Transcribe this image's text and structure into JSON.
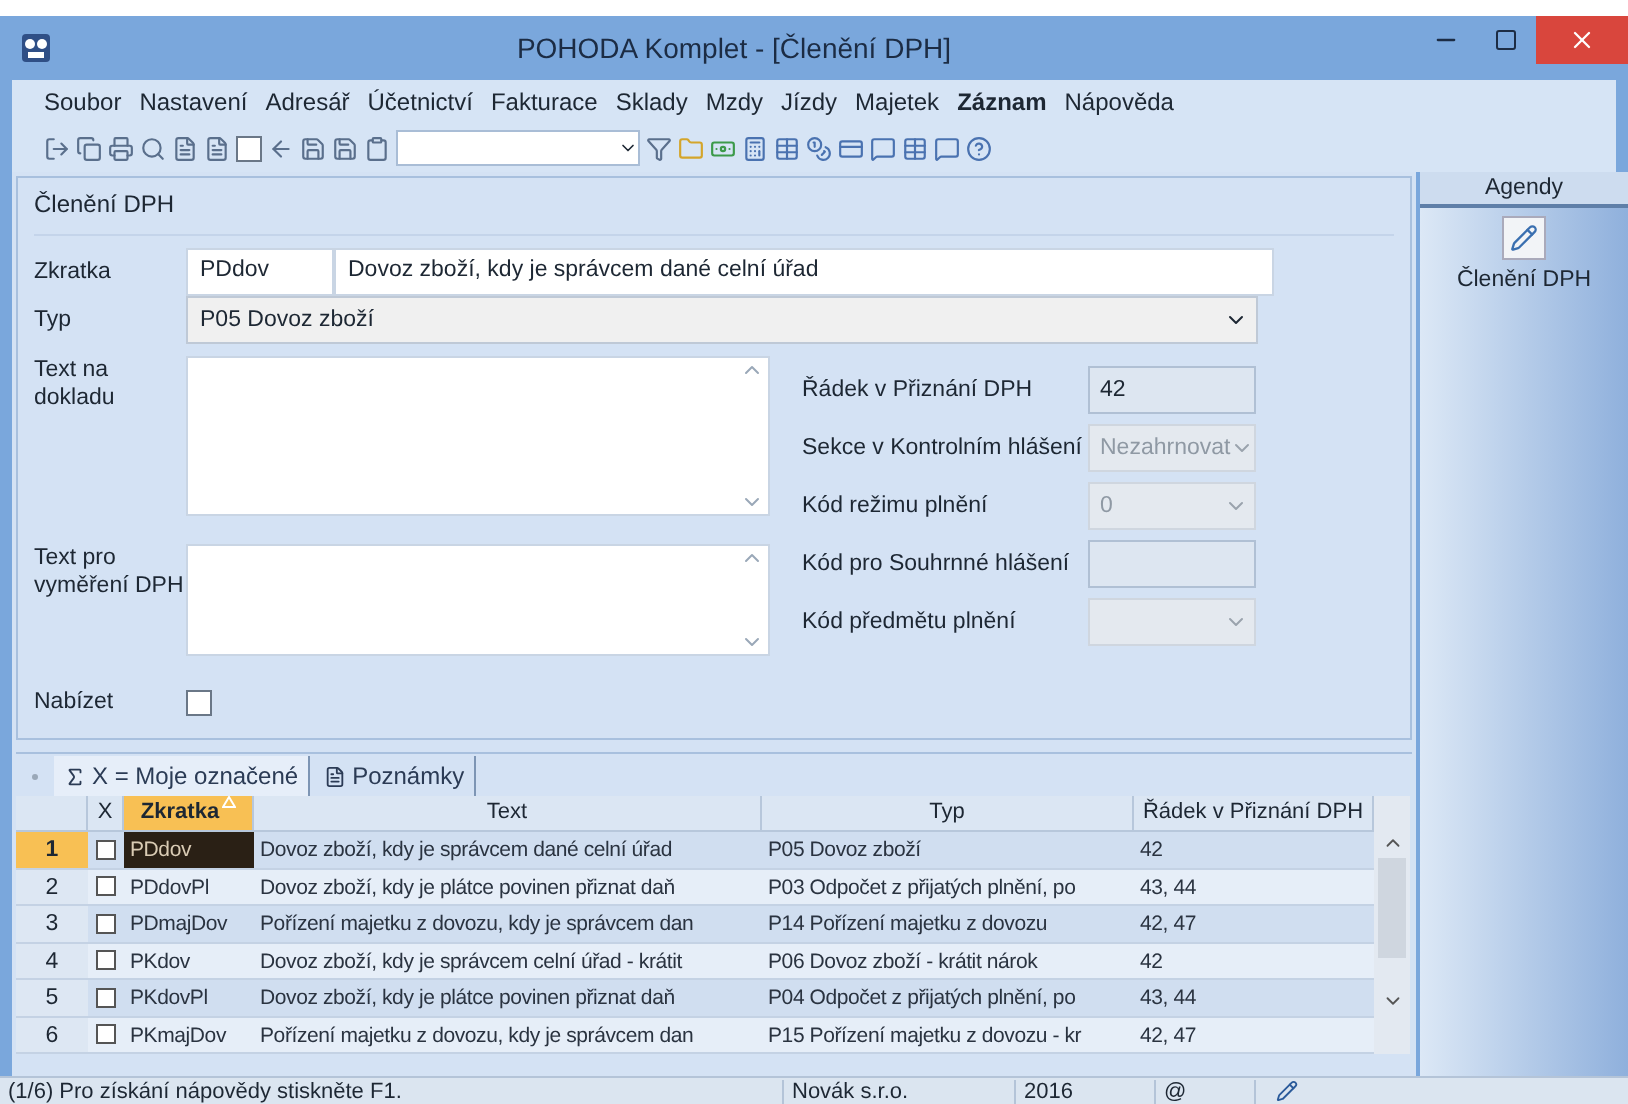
{
  "window": {
    "title": "POHODA Komplet - [Členění DPH]"
  },
  "menu": [
    {
      "label": "Soubor",
      "bold": false
    },
    {
      "label": "Nastavení",
      "bold": false
    },
    {
      "label": "Adresář",
      "bold": false
    },
    {
      "label": "Účetnictví",
      "bold": false
    },
    {
      "label": "Fakturace",
      "bold": false
    },
    {
      "label": "Sklady",
      "bold": false
    },
    {
      "label": "Mzdy",
      "bold": false
    },
    {
      "label": "Jízdy",
      "bold": false
    },
    {
      "label": "Majetek",
      "bold": false
    },
    {
      "label": "Záznam",
      "bold": true
    },
    {
      "label": "Nápověda",
      "bold": false
    }
  ],
  "form": {
    "title": "Členění DPH",
    "zkratka": {
      "label": "Zkratka",
      "code": "PDdov",
      "name": "Dovoz zboží, kdy je správcem dané celní úřad"
    },
    "typ": {
      "label": "Typ",
      "value": "P05 Dovoz zboží"
    },
    "text_na_dokladu": {
      "label": "Text na dokladu"
    },
    "text_pro_vymereni": {
      "label": "Text pro vyměření DPH"
    },
    "nabizet": {
      "label": "Nabízet",
      "checked": false
    },
    "right_fields": [
      {
        "label": "Řádek v Přiznání DPH",
        "value": "42",
        "kind": "text",
        "disabled": false
      },
      {
        "label": "Sekce v Kontrolním hlášení",
        "value": "Nezahrnovat",
        "kind": "select",
        "disabled": true
      },
      {
        "label": "Kód režimu plnění",
        "value": "0",
        "kind": "select",
        "disabled": true
      },
      {
        "label": "Kód pro Souhrnné hlášení",
        "kind": "text",
        "disabled": false
      },
      {
        "label": "Kód předmětu plnění",
        "kind": "select",
        "disabled": true
      }
    ]
  },
  "agendy": {
    "title": "Agendy",
    "items": [
      {
        "label": "Členění DPH"
      }
    ]
  },
  "tabs": [
    {
      "label": "X = Moje označené",
      "selected": true
    },
    {
      "label": "Poznámky",
      "selected": false
    }
  ],
  "table": {
    "check_column": "X",
    "columns": [
      "Zkratka",
      "Text",
      "Typ",
      "Řádek v Přiznání DPH"
    ],
    "rows": [
      {
        "number": "1",
        "checked": false,
        "selected": true,
        "cells": [
          "PDdov",
          "Dovoz zboží, kdy je správcem dané celní úřad",
          "P05 Dovoz zboží",
          "42"
        ]
      },
      {
        "number": "2",
        "checked": false,
        "selected": false,
        "cells": [
          "PDdovPl",
          "Dovoz zboží, kdy je plátce povinen přiznat daň",
          "P03 Odpočet z přijatých plnění, po",
          "43, 44"
        ]
      },
      {
        "number": "3",
        "checked": false,
        "selected": false,
        "cells": [
          "PDmajDov",
          "Pořízení majetku z dovozu, kdy je správcem dan",
          "P14 Pořízení majetku z dovozu",
          "42, 47"
        ]
      },
      {
        "number": "4",
        "checked": false,
        "selected": false,
        "cells": [
          "PKdov",
          "Dovoz zboží, kdy je správcem celní úřad - krátit",
          "P06 Dovoz zboží - krátit nárok",
          "42"
        ]
      },
      {
        "number": "5",
        "checked": false,
        "selected": false,
        "cells": [
          "PKdovPl",
          "Dovoz zboží, kdy je plátce povinen přiznat daň",
          "P04 Odpočet z přijatých plnění, po",
          "43, 44"
        ]
      },
      {
        "number": "6",
        "checked": false,
        "selected": false,
        "cells": [
          "PKmajDov",
          "Pořízení majetku z dovozu, kdy je správcem dan",
          "P15 Pořízení majetku z dovozu - kr",
          "42, 47"
        ]
      }
    ]
  },
  "status_bar": {
    "hint": "(1/6) Pro získání nápovědy stiskněte F1.",
    "company": "Novák s.r.o.",
    "year": "2016",
    "mail": "@"
  }
}
